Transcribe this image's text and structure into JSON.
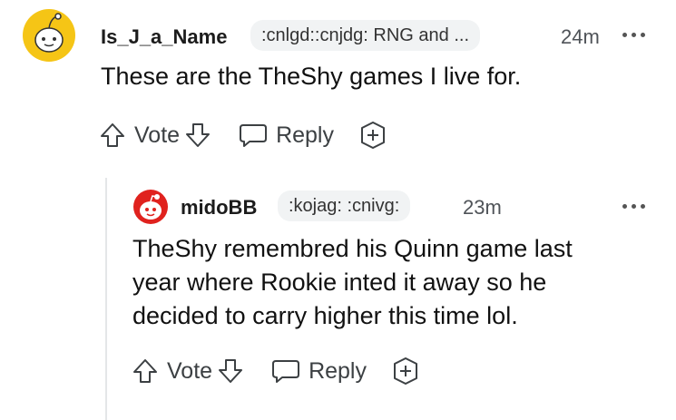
{
  "comments": [
    {
      "username": "Is_J_a_Name",
      "flair": ":cnlgd::cnjdg: RNG and ...",
      "time": "24m",
      "body": "These are the TheShy games I live for.",
      "actions": {
        "vote": "Vote",
        "reply": "Reply"
      }
    },
    {
      "username": "midoBB",
      "flair": ":kojag: :cnivg:",
      "time": "23m",
      "body": "TheShy remembred his Quinn game last year where Rookie inted it away so he decided to carry higher this time lol.",
      "actions": {
        "vote": "Vote",
        "reply": "Reply"
      }
    }
  ],
  "colors": {
    "avatar1_bg": "#f5c516",
    "avatar2_bg": "#e0221e",
    "flair_bg": "#f1f3f4"
  },
  "icons": [
    "upvote-icon",
    "downvote-icon",
    "reply-bubble-icon",
    "award-plus-icon",
    "more-options-icon"
  ]
}
